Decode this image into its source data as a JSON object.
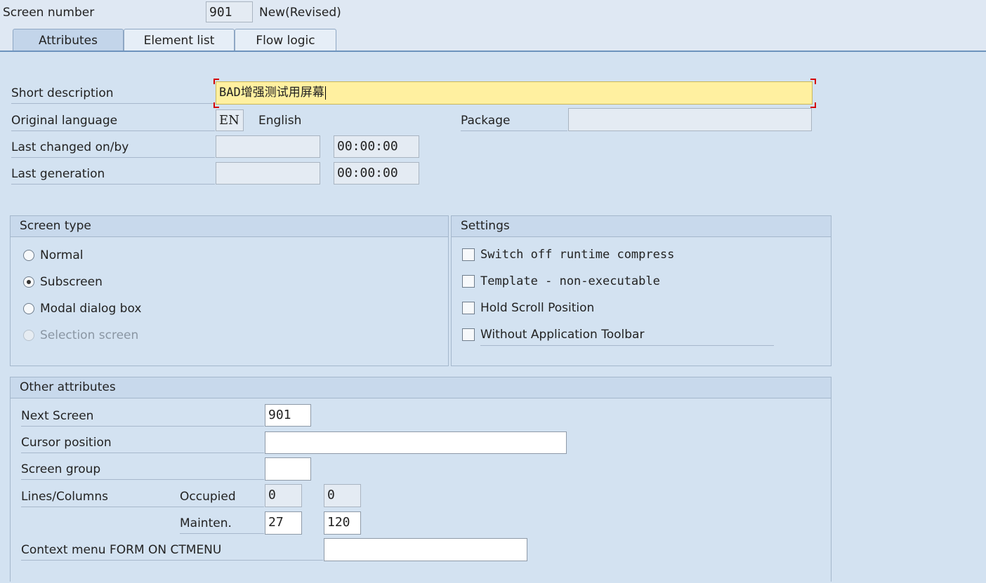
{
  "header": {
    "screen_number_label": "Screen number",
    "screen_number_value": "901",
    "status": "New(Revised)"
  },
  "tabs": [
    {
      "label": "Attributes",
      "active": true
    },
    {
      "label": "Element list",
      "active": false
    },
    {
      "label": "Flow logic",
      "active": false
    }
  ],
  "attributes": {
    "short_description_label": "Short description",
    "short_description_value": "BAD增强测试用屏幕",
    "original_language_label": "Original language",
    "original_language_code": "EN",
    "original_language_name": "English",
    "package_label": "Package",
    "package_value": "",
    "last_changed_label": "Last changed on/by",
    "last_changed_date": "",
    "last_changed_time": "00:00:00",
    "last_generation_label": "Last generation",
    "last_generation_date": "",
    "last_generation_time": "00:00:00"
  },
  "screen_type": {
    "title": "Screen type",
    "options": [
      {
        "label": "Normal",
        "selected": false,
        "enabled": true
      },
      {
        "label": "Subscreen",
        "selected": true,
        "enabled": true
      },
      {
        "label": "Modal dialog box",
        "selected": false,
        "enabled": true
      },
      {
        "label": "Selection screen",
        "selected": false,
        "enabled": false
      }
    ]
  },
  "settings": {
    "title": "Settings",
    "options": [
      {
        "label": "Switch off runtime compress",
        "checked": false
      },
      {
        "label": "Template - non-executable",
        "checked": false
      },
      {
        "label": "Hold Scroll Position",
        "checked": false
      },
      {
        "label": "Without Application Toolbar",
        "checked": false
      }
    ]
  },
  "other_attributes": {
    "title": "Other attributes",
    "next_screen_label": "Next Screen",
    "next_screen_value": "901",
    "cursor_position_label": "Cursor position",
    "cursor_position_value": "",
    "screen_group_label": "Screen group",
    "screen_group_value": "",
    "lines_columns_label": "Lines/Columns",
    "occupied_label": "Occupied",
    "occupied_lines": "0",
    "occupied_columns": "0",
    "mainten_label": "Mainten.",
    "mainten_lines": "27",
    "mainten_columns": "120",
    "context_menu_label": "Context menu FORM ON CTMENU",
    "context_menu_value": ""
  }
}
